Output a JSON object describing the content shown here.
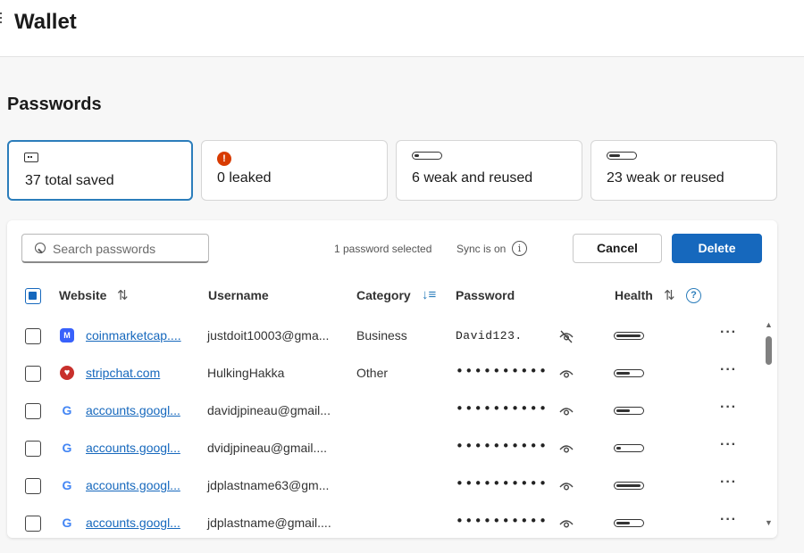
{
  "header": {
    "title": "Wallet"
  },
  "section": {
    "title": "Passwords"
  },
  "stats": [
    {
      "label": "37 total saved",
      "icon": "card-icon"
    },
    {
      "label": "0 leaked",
      "icon": "alert-icon",
      "badge": "!"
    },
    {
      "label": "6 weak and reused",
      "icon": "health-bar-icon",
      "strength_fraction": 0.2
    },
    {
      "label": "23 weak or reused",
      "icon": "health-bar-icon",
      "strength_fraction": 0.45
    }
  ],
  "toolbar": {
    "search_placeholder": "Search passwords",
    "selected_text": "1 password selected",
    "sync_text": "Sync is on",
    "info_glyph": "i",
    "cancel_label": "Cancel",
    "delete_label": "Delete"
  },
  "columns": {
    "website": "Website",
    "username": "Username",
    "category": "Category",
    "password": "Password",
    "health": "Health",
    "help_glyph": "?"
  },
  "rows": [
    {
      "site": "coinmarketcap....",
      "icon": "coinmarketcap-icon",
      "icon_glyph": "M",
      "username": "justdoit10003@gma...",
      "category": "Business",
      "password": "David123.",
      "revealed": true,
      "health_fraction": 1.0
    },
    {
      "site": "stripchat.com",
      "icon": "stripchat-icon",
      "icon_glyph": "♥",
      "username": "HulkingHakka",
      "category": "Other",
      "password": "••••••••••",
      "revealed": false,
      "health_fraction": 0.55
    },
    {
      "site": "accounts.googl...",
      "icon": "google-icon",
      "icon_glyph": "G",
      "username": "davidjpineau@gmail...",
      "category": "",
      "password": "••••••••••",
      "revealed": false,
      "health_fraction": 0.55
    },
    {
      "site": "accounts.googl...",
      "icon": "google-icon",
      "icon_glyph": "G",
      "username": "dvidjpineau@gmail....",
      "category": "",
      "password": "••••••••••",
      "revealed": false,
      "health_fraction": 0.2
    },
    {
      "site": "accounts.googl...",
      "icon": "google-icon",
      "icon_glyph": "G",
      "username": "jdplastname63@gm...",
      "category": "",
      "password": "••••••••••",
      "revealed": false,
      "health_fraction": 1.0
    },
    {
      "site": "accounts.googl...",
      "icon": "google-icon",
      "icon_glyph": "G",
      "username": "jdplastname@gmail....",
      "category": "",
      "password": "••••••••••",
      "revealed": false,
      "health_fraction": 0.55
    }
  ],
  "more_glyph": "···",
  "colors": {
    "accent": "#1668bd",
    "active_border": "#2b7dbb",
    "leak_red": "#d83b01"
  }
}
